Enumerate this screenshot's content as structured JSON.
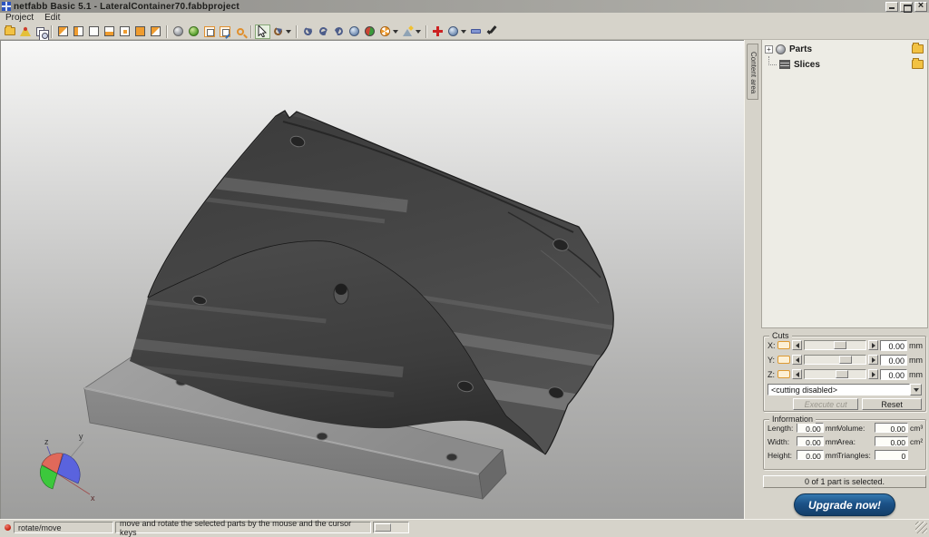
{
  "window": {
    "title": "netfabb Basic 5.1 - LateralContainer70.fabbproject"
  },
  "menu": {
    "items": [
      {
        "label": "Project"
      },
      {
        "label": "Edit"
      }
    ]
  },
  "toolbar": {
    "icons": [
      "open-project",
      "add-part",
      "copy-part",
      "view-cube-iso",
      "view-cube-front",
      "view-cube-back",
      "view-cube-left",
      "view-cube-right",
      "view-cube-top",
      "view-cube-bottom",
      "shaded-view",
      "material-view",
      "bounding-box",
      "edit-box",
      "zoom",
      "select-cursor",
      "rotate-tool",
      "rotate-x",
      "rotate-y",
      "rotate-z",
      "sphere-view",
      "collision-view",
      "cut-wheel",
      "repair-wizard",
      "add-triangle",
      "repair-script",
      "remove-triangle",
      "apply-repair"
    ]
  },
  "sidebar": {
    "context_tab": "Content area",
    "tree": {
      "expander": "+",
      "items": [
        {
          "label": "Parts"
        },
        {
          "label": "Slices"
        }
      ]
    },
    "cuts": {
      "title": "Cuts",
      "rows": [
        {
          "label": "X:",
          "value": "0.00",
          "unit": "mm"
        },
        {
          "label": "Y:",
          "value": "0.00",
          "unit": "mm"
        },
        {
          "label": "Z:",
          "value": "0.00",
          "unit": "mm"
        }
      ],
      "mode": "<cutting disabled>",
      "execute_label": "Execute cut",
      "reset_label": "Reset"
    },
    "information": {
      "title": "Information",
      "rows": [
        {
          "l1": "Length:",
          "v1": "0.00",
          "u1": "mm",
          "l2": "Volume:",
          "v2": "0.00",
          "u2": "cm³"
        },
        {
          "l1": "Width:",
          "v1": "0.00",
          "u1": "mm",
          "l2": "Area:",
          "v2": "0.00",
          "u2": "cm²"
        },
        {
          "l1": "Height:",
          "v1": "0.00",
          "u1": "mm",
          "l2": "Triangles:",
          "v2": "0",
          "u2": ""
        }
      ]
    },
    "selection_status": "0 of 1 part is selected.",
    "upgrade_label": "Upgrade now!"
  },
  "statusbar": {
    "mode": "rotate/move",
    "hint": "move and rotate the selected parts by the mouse and the cursor keys"
  },
  "viewport": {
    "axis_labels": {
      "z": "z",
      "y": "y",
      "x": "x"
    }
  },
  "colors": {
    "panel": "#d6d3ca",
    "accent_orange": "#ef9c2f",
    "upgrade_blue": "#1b5187",
    "status_red": "#c01808",
    "model_dark": "#454545",
    "model_base": "#8e8e8e"
  }
}
